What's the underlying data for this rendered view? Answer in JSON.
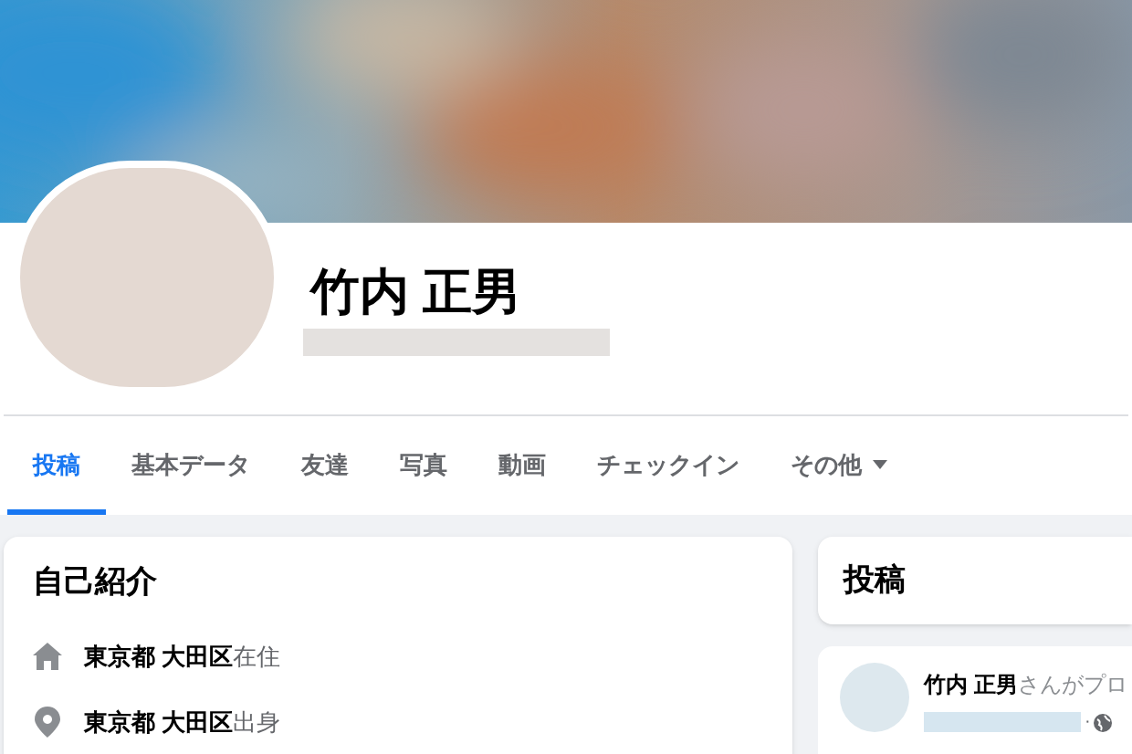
{
  "profile": {
    "name": "竹内 正男"
  },
  "tabs": [
    {
      "label": "投稿",
      "selected": true
    },
    {
      "label": "基本データ",
      "selected": false
    },
    {
      "label": "友達",
      "selected": false
    },
    {
      "label": "写真",
      "selected": false
    },
    {
      "label": "動画",
      "selected": false
    },
    {
      "label": "チェックイン",
      "selected": false
    },
    {
      "label": "その他",
      "selected": false,
      "kind": "dropdown"
    }
  ],
  "intro": {
    "title": "自己紹介",
    "items": [
      {
        "kind": "home",
        "text": "**東京都 大田区**在住"
      },
      {
        "kind": "pin",
        "text": "**東京都 大田区**出身"
      }
    ]
  },
  "posts": {
    "title": "投稿",
    "post": {
      "text": "**竹内 正男**さんがプロ",
      "separator": "·"
    }
  }
}
